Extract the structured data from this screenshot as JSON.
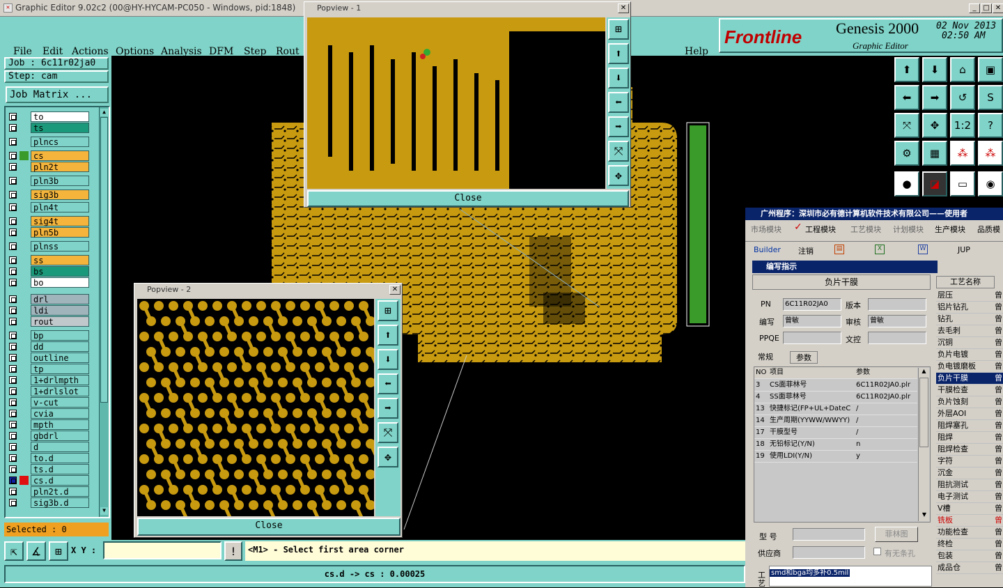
{
  "window": {
    "title": "Graphic Editor 9.02c2 (00@HY-HYCAM-PC050 - Windows, pid:1848)"
  },
  "menu": {
    "items": [
      "File",
      "Edit",
      "Actions",
      "Options",
      "Analysis",
      "DFM",
      "Step",
      "Rout"
    ],
    "help": "Help"
  },
  "logo": {
    "brand": "Frontline",
    "product": "Genesis 2000",
    "subtitle": "Graphic Editor",
    "date": "02 Nov 2013",
    "time": "02:50 AM"
  },
  "job": {
    "job_label": "Job : 6c11r02ja0",
    "step_label": "Step: cam",
    "matrix_button": "Job Matrix ..."
  },
  "layers": [
    {
      "name": "to",
      "color": "#ffffff"
    },
    {
      "name": "ts",
      "color": "#1a9a7a"
    },
    {
      "name": "plncs",
      "color": "#7fd3c8"
    },
    {
      "name": "cs",
      "color": "#f5b53c"
    },
    {
      "name": "pln2t",
      "color": "#f5b53c"
    },
    {
      "name": "pln3b",
      "color": "#7fd3c8"
    },
    {
      "name": "sig3b",
      "color": "#f5b53c"
    },
    {
      "name": "pln4t",
      "color": "#7fd3c8"
    },
    {
      "name": "sig4t",
      "color": "#f5b53c"
    },
    {
      "name": "pln5b",
      "color": "#f5b53c"
    },
    {
      "name": "plnss",
      "color": "#7fd3c8"
    },
    {
      "name": "ss",
      "color": "#f5b53c"
    },
    {
      "name": "bs",
      "color": "#1a9a7a"
    },
    {
      "name": "bo",
      "color": "#ffffff"
    },
    {
      "name": "drl",
      "color": "#a0b4bc"
    },
    {
      "name": "ldi",
      "color": "#a0b4bc"
    },
    {
      "name": "rout",
      "color": "#c0c8cc"
    },
    {
      "name": "bp",
      "color": "#7fd3c8"
    },
    {
      "name": "dd",
      "color": "#7fd3c8"
    },
    {
      "name": "outline",
      "color": "#7fd3c8"
    },
    {
      "name": "tp",
      "color": "#7fd3c8"
    },
    {
      "name": "1+drlmpth",
      "color": "#7fd3c8"
    },
    {
      "name": "1+drlslot",
      "color": "#7fd3c8"
    },
    {
      "name": "v-cut",
      "color": "#7fd3c8"
    },
    {
      "name": "cvia",
      "color": "#7fd3c8"
    },
    {
      "name": "mpth",
      "color": "#7fd3c8"
    },
    {
      "name": "gbdrl",
      "color": "#7fd3c8"
    },
    {
      "name": "d",
      "color": "#7fd3c8"
    },
    {
      "name": "to.d",
      "color": "#7fd3c8"
    },
    {
      "name": "ts.d",
      "color": "#7fd3c8"
    },
    {
      "name": "cs.d",
      "color": "#7fd3c8"
    },
    {
      "name": "pln2t.d",
      "color": "#7fd3c8"
    },
    {
      "name": "sig3b.d",
      "color": "#7fd3c8"
    }
  ],
  "selected": "Selected : 0",
  "popups": [
    {
      "title": "Popview - 1",
      "close": "Close"
    },
    {
      "title": "Popview - 2",
      "close": "Close"
    }
  ],
  "status": {
    "xy_label": "X Y :",
    "xy_value": "",
    "exclaim": "!",
    "prompt": "<M1> - Select first area corner",
    "bottom": "cs.d -> cs : 0.00025"
  },
  "cn": {
    "title": "广州程序：深圳市必有德计算机软件技术有限公司——使用者",
    "tabs": [
      "市场模块",
      "工程模块",
      "工艺模块",
      "计划模块",
      "生产模块",
      "品质模"
    ],
    "toolbar": [
      "Builder",
      "注销",
      "JUP"
    ],
    "sub_title": "编写指示",
    "process_title": "负片干膜",
    "fields": {
      "pn_label": "PN",
      "pn_value": "6C11R02JA0",
      "ver_label": "版本",
      "ver_value": "",
      "author_label": "编写",
      "author_value": "曾敏",
      "review_label": "审核",
      "review_value": "曾敏",
      "ppqe_label": "PPQE",
      "ppqe_value": "",
      "wenkong_label": "文控",
      "wenkong_value": ""
    },
    "subtabs": [
      "常规",
      "参数"
    ],
    "grid_headers": [
      "NO",
      "项目",
      "参数"
    ],
    "grid_rows": [
      [
        "3",
        "CS面菲林号",
        "6C11R02JA0.plr"
      ],
      [
        "4",
        "SS面菲林号",
        "6C11R02JA0.plr"
      ],
      [
        "13",
        "快捷标记(FP+UL+DateC",
        "/"
      ],
      [
        "14",
        "生产周期(YYWW/WWYY)",
        "/"
      ],
      [
        "17",
        "干膜型号",
        "/"
      ],
      [
        "18",
        "无铅标记(Y/N)",
        "n"
      ],
      [
        "19",
        "使用LDI(Y/N)",
        "y"
      ]
    ],
    "model_label": "型 号",
    "supplier_label": "供应商",
    "film_btn": "菲林图",
    "no_hole": "有无条孔",
    "note_label": "工艺",
    "note_value": "smd和bga均多补0.5mil",
    "proc_header": "工艺名称",
    "processes": [
      "层压",
      "铝片钻孔",
      "钻孔",
      "去毛刺",
      "沉铜",
      "负片电镀",
      "负电镀磨板",
      "负片干膜",
      "干膜检查",
      "负片蚀刻",
      "外层AOI",
      "阻焊塞孔",
      "阻焊",
      "阻焊检查",
      "字符",
      "沉金",
      "阻抗测试",
      "电子测试",
      "V槽",
      "铣板",
      "功能检查",
      "终检",
      "包装",
      "成品仓"
    ],
    "proc_suffix": "曾"
  }
}
